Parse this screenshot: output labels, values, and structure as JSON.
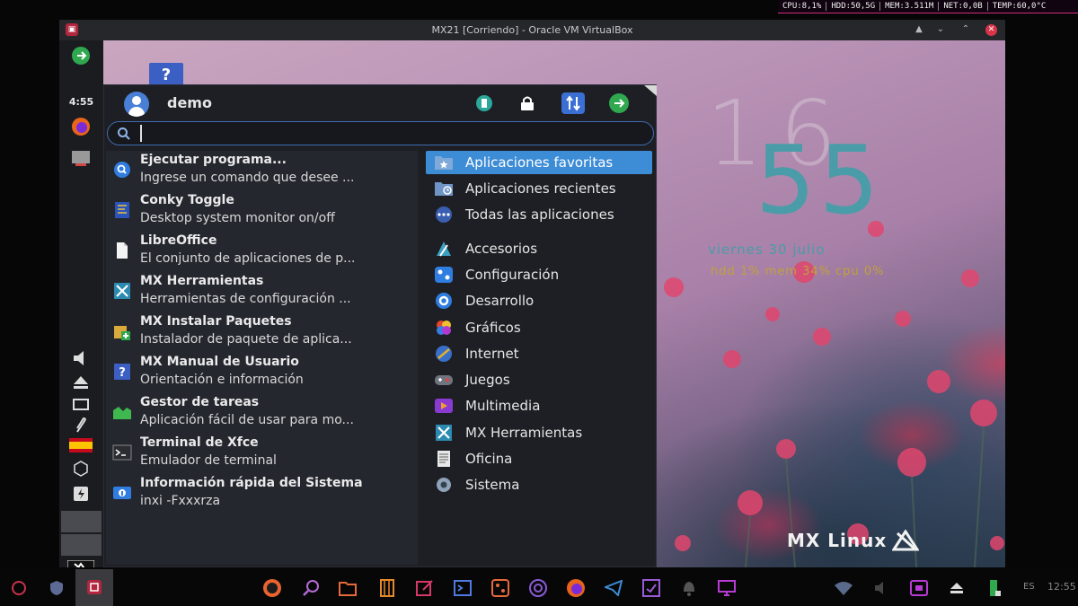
{
  "host_status": {
    "cpu": "CPU:8,1%",
    "hdd": "HDD:50,5G",
    "mem": "MEM:3.511M",
    "net": "NET:0,0B",
    "temp": "TEMP:60,0°C"
  },
  "window": {
    "title": "MX21 [Corriendo] - Oracle VM VirtualBox"
  },
  "guest_dock": {
    "time": "4:55"
  },
  "desktop": {
    "help_glyph": "?"
  },
  "conky": {
    "hour_text": "16",
    "minute_text": "55",
    "date": "viernes  30 julio",
    "stats": "hdd  1%  mem  34%  cpu    0%"
  },
  "wallpaper_logo": "MX Linux",
  "menu": {
    "username": "demo",
    "search": {
      "value": "",
      "placeholder": ""
    },
    "apps": [
      {
        "title": "Ejecutar programa...",
        "desc": "Ingrese un comando que desee ...",
        "icon": "run-icon"
      },
      {
        "title": "Conky Toggle",
        "desc": "Desktop system monitor on/off",
        "icon": "conky-icon"
      },
      {
        "title": "LibreOffice",
        "desc": "El conjunto de aplicaciones de p...",
        "icon": "libreoffice-icon"
      },
      {
        "title": "MX Herramientas",
        "desc": "Herramientas de configuración ...",
        "icon": "mx-tools-icon"
      },
      {
        "title": "MX Instalar Paquetes",
        "desc": "Instalador de paquete de aplica...",
        "icon": "package-installer-icon"
      },
      {
        "title": "MX Manual de Usuario",
        "desc": "Orientación e información",
        "icon": "help-icon"
      },
      {
        "title": "Gestor de tareas",
        "desc": "Aplicación fácil de usar para mo...",
        "icon": "task-manager-icon"
      },
      {
        "title": "Terminal de Xfce",
        "desc": "Emulador de terminal",
        "icon": "terminal-icon"
      },
      {
        "title": "Información rápida del Sistema",
        "desc": "inxi -Fxxxrza",
        "icon": "system-info-icon"
      }
    ],
    "categories": [
      {
        "label": "Aplicaciones favoritas",
        "icon": "favorites-folder-icon",
        "active": true
      },
      {
        "label": "Aplicaciones recientes",
        "icon": "recent-folder-icon"
      },
      {
        "label": "Todas las aplicaciones",
        "icon": "all-apps-icon"
      },
      {
        "label": "Accesorios",
        "icon": "accessories-icon"
      },
      {
        "label": "Configuración",
        "icon": "settings-icon"
      },
      {
        "label": "Desarrollo",
        "icon": "development-icon"
      },
      {
        "label": "Gráficos",
        "icon": "graphics-icon"
      },
      {
        "label": "Internet",
        "icon": "internet-icon"
      },
      {
        "label": "Juegos",
        "icon": "games-icon"
      },
      {
        "label": "Multimedia",
        "icon": "multimedia-icon"
      },
      {
        "label": "MX Herramientas",
        "icon": "mx-tools-icon"
      },
      {
        "label": "Oficina",
        "icon": "office-icon"
      },
      {
        "label": "Sistema",
        "icon": "system-icon"
      }
    ]
  },
  "host_taskbar": {
    "lang": "ES",
    "time": "12:55"
  },
  "colors": {
    "accent": "#3d8cd6",
    "menu_bg": "#1e1f25",
    "conky_teal": "#4a9ca8",
    "conky_gold": "#c0a13a",
    "status_border": "#d42a7a"
  }
}
